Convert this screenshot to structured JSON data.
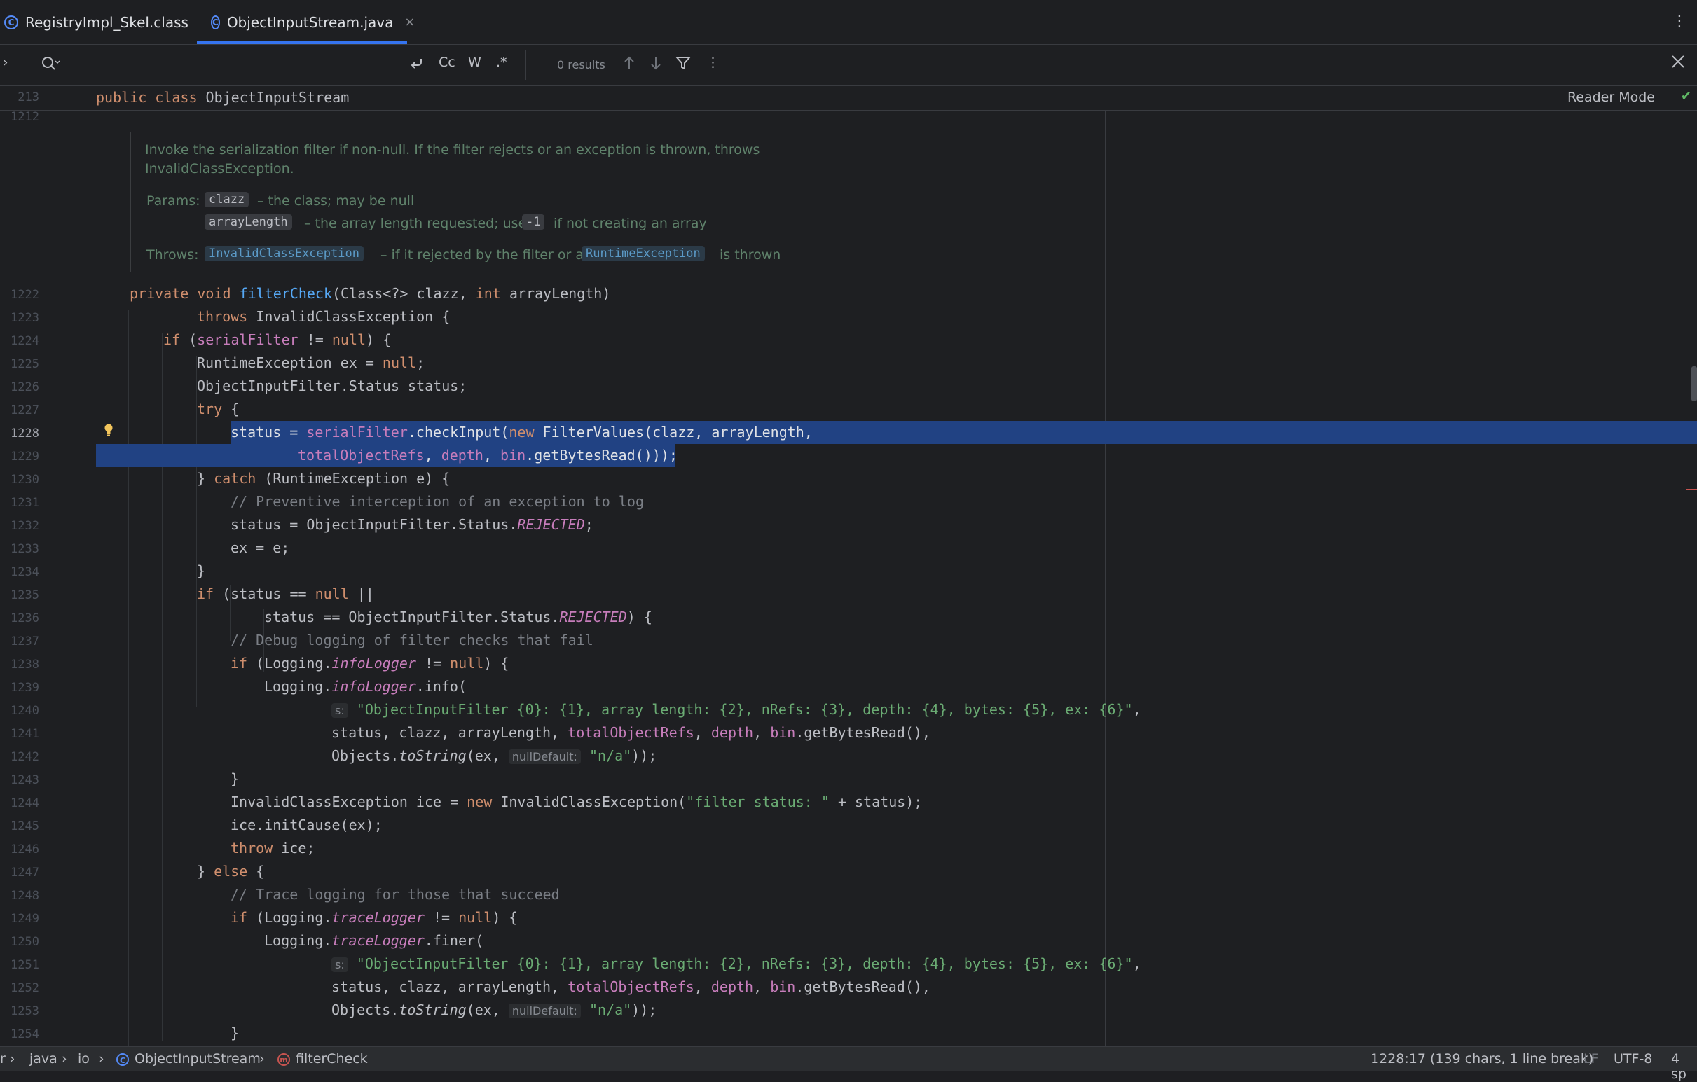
{
  "tabs": [
    {
      "label": "RegistryImpl_Skel.class"
    },
    {
      "label": "ObjectInputStream.java",
      "close": "×"
    }
  ],
  "find": {
    "results": "0 results",
    "cc": "Cc",
    "w": "W",
    "regex": ".*"
  },
  "sticky": {
    "line_number": "213",
    "code_kw": "public class ",
    "code_name": "ObjectInputStream",
    "second_line_number": "1212",
    "reader_mode": "Reader Mode"
  },
  "doc": {
    "line1": "Invoke the serialization filter if non-null. If the filter rejects or an exception is thrown, throws",
    "line2": "InvalidClassException.",
    "params_label": "Params:",
    "param1": "clazz",
    "param1_desc": "– the class; may be null",
    "param2": "arrayLength",
    "param2_desc": "– the array length requested; use",
    "param2_code": "-1",
    "param2_tail": "if not creating an array",
    "throws_label": "Throws:",
    "throws1": "InvalidClassException",
    "throws_mid": "– if it rejected by the filter or a",
    "throws2": "RuntimeException",
    "throws_tail": "is thrown"
  },
  "lines": [
    "1222",
    "1223",
    "1224",
    "1225",
    "1226",
    "1227",
    "1228",
    "1229",
    "1230",
    "1231",
    "1232",
    "1233",
    "1234",
    "1235",
    "1236",
    "1237",
    "1238",
    "1239",
    "1240",
    "1241",
    "1242",
    "1243",
    "1244",
    "1245",
    "1246",
    "1247",
    "1248",
    "1249",
    "1250",
    "1251",
    "1252",
    "1253",
    "1254"
  ],
  "hints": {
    "s": "s:",
    "null_default": "nullDefault:"
  },
  "status": {
    "crumbs": [
      "java",
      "io",
      "ObjectInputStream",
      "filterCheck"
    ],
    "position": "1228:17 (139 chars, 1 line break)",
    "line_sep": "LF",
    "encoding": "UTF-8",
    "indent": "4 sp"
  },
  "colors": {
    "selection": "#214283",
    "keyword": "#cf8e6d",
    "function": "#56a8f5",
    "field": "#c77dbb",
    "string": "#6aab73"
  }
}
